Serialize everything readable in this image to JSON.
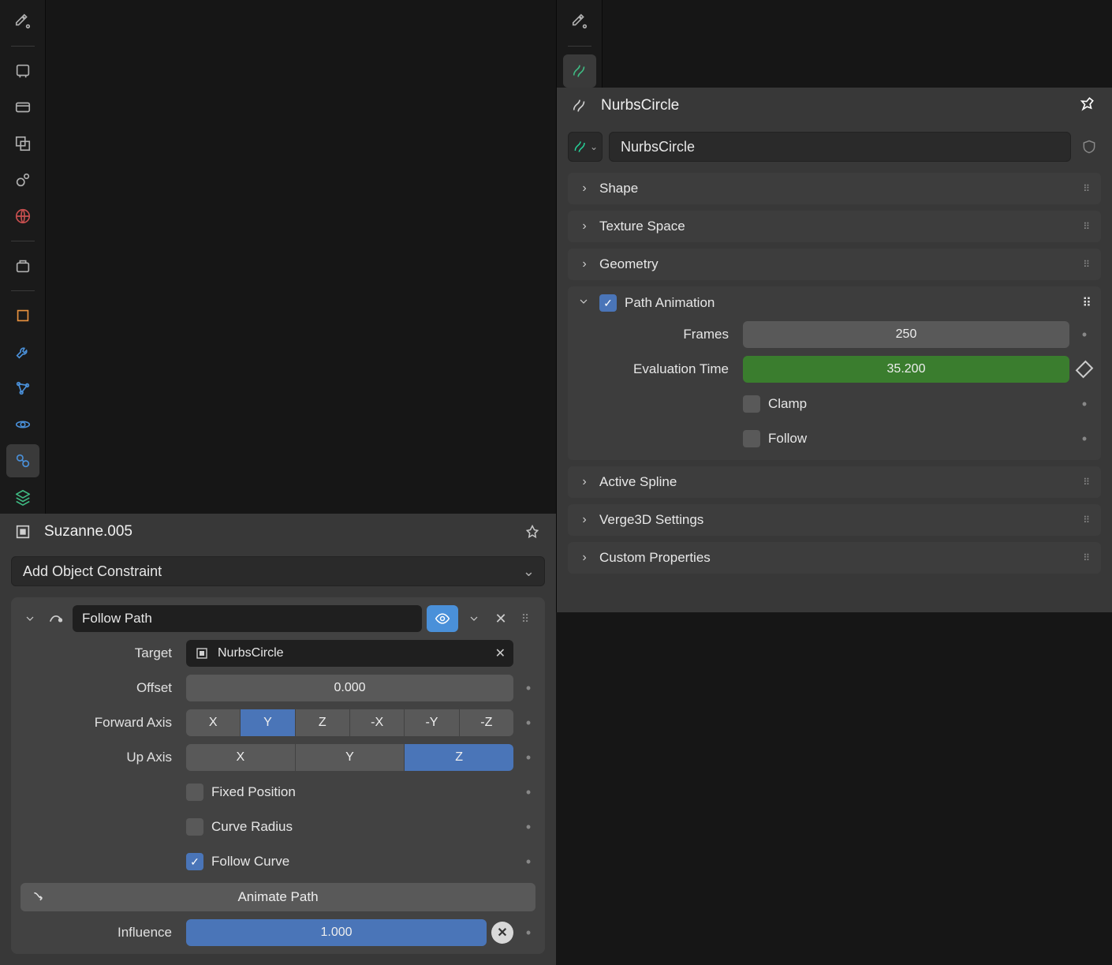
{
  "left": {
    "object_name": "Suzanne.005",
    "add_constraint_label": "Add Object Constraint",
    "constraint": {
      "name": "Follow Path",
      "target_label": "Target",
      "target_value": "NurbsCircle",
      "offset_label": "Offset",
      "offset_value": "0.000",
      "forward_label": "Forward Axis",
      "forward_options": [
        "X",
        "Y",
        "Z",
        "-X",
        "-Y",
        "-Z"
      ],
      "forward_active": "Y",
      "up_label": "Up Axis",
      "up_options": [
        "X",
        "Y",
        "Z"
      ],
      "up_active": "Z",
      "fixed_position_label": "Fixed Position",
      "curve_radius_label": "Curve Radius",
      "follow_curve_label": "Follow Curve",
      "animate_path_label": "Animate Path",
      "influence_label": "Influence",
      "influence_value": "1.000"
    }
  },
  "right": {
    "object_name": "NurbsCircle",
    "data_name": "NurbsCircle",
    "sections": {
      "shape": "Shape",
      "texture_space": "Texture Space",
      "geometry": "Geometry",
      "path_animation": "Path Animation",
      "active_spline": "Active Spline",
      "verge3d": "Verge3D Settings",
      "custom_props": "Custom Properties"
    },
    "path_anim": {
      "frames_label": "Frames",
      "frames_value": "250",
      "eval_label": "Evaluation Time",
      "eval_value": "35.200",
      "clamp_label": "Clamp",
      "follow_label": "Follow"
    }
  }
}
